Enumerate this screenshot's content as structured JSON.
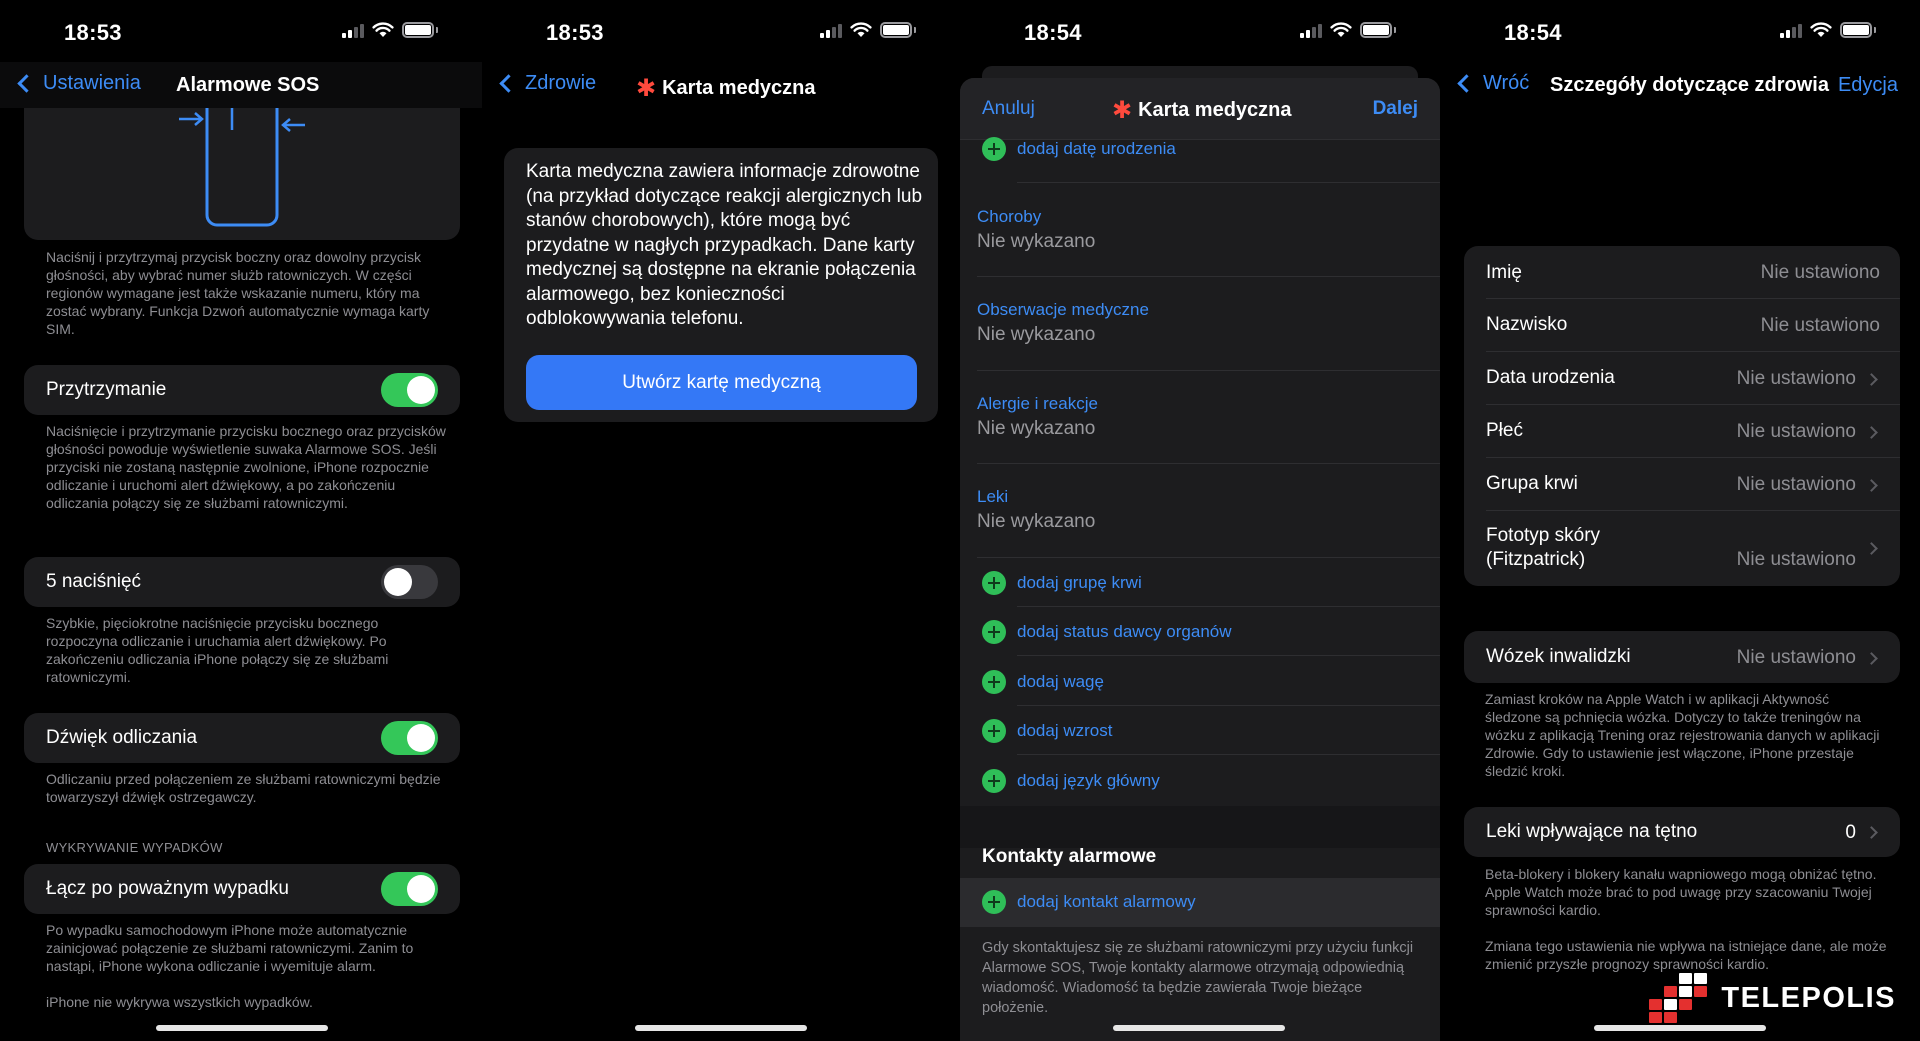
{
  "status": {
    "time_1": "18:53",
    "time_2": "18:53",
    "time_3": "18:54",
    "time_4": "18:54"
  },
  "p1": {
    "back_label": "Ustawienia",
    "title": "Alarmowe SOS",
    "intro": "Naciśnij i przytrzymaj przycisk boczny oraz dowolny przycisk głośności, aby wybrać numer służb ratowniczych. W części regionów wymagane jest także wskazanie numeru, który ma zostać wybrany. Funkcja Dzwoń automatycznie wymaga karty SIM.",
    "hold_label": "Przytrzymanie",
    "hold_on": true,
    "hold_desc": "Naciśnięcie i przytrzymanie przycisku bocznego oraz przycisków głośności powoduje wyświetlenie suwaka Alarmowe SOS. Jeśli przyciski nie zostaną następnie zwolnione, iPhone rozpocznie odliczanie i uruchomi alert dźwiękowy, a po zakończeniu odliczania połączy się ze służbami ratowniczymi.",
    "five_label": "5 naciśnięć",
    "five_on": false,
    "five_desc": "Szybkie, pięciokrotne naciśnięcie przycisku bocznego rozpoczyna odliczanie i uruchamia alert dźwiękowy. Po zakończeniu odliczania iPhone połączy się ze służbami ratowniczymi.",
    "sound_label": "Dźwięk odliczania",
    "sound_on": true,
    "sound_desc": "Odliczaniu przed połączeniem ze służbami ratowniczymi będzie towarzyszył dźwięk ostrzegawczy.",
    "section_header": "WYKRYWANIE WYPADKÓW",
    "crash_label": "Łącz po poważnym wypadku",
    "crash_on": true,
    "crash_desc": "Po wypadku samochodowym iPhone może automatycznie zainicjować połączenie ze służbami ratowniczymi. Zanim to nastąpi, iPhone wykona odliczanie i wyemituje alarm.",
    "crash_note": "iPhone nie wykrywa wszystkich wypadków."
  },
  "p2": {
    "back_label": "Zdrowie",
    "title": "Karta medyczna",
    "info": "Karta medyczna zawiera informacje zdrowotne (na przykład dotyczące reakcji alergicznych lub stanów chorobowych), które mogą być przydatne w nagłych przypadkach. Dane karty medycznej są dostępne na ekranie połączenia alarmowego, bez konieczności odblokowywania telefonu.",
    "create_button": "Utwórz kartę medyczną"
  },
  "p3": {
    "cancel": "Anuluj",
    "title": "Karta medyczna",
    "next": "Dalej",
    "add_birthdate": "dodaj datę urodzenia",
    "fields": [
      {
        "label": "Choroby",
        "value": "Nie wykazano"
      },
      {
        "label": "Obserwacje medyczne",
        "value": "Nie wykazano"
      },
      {
        "label": "Alergie i reakcje",
        "value": "Nie wykazano"
      },
      {
        "label": "Leki",
        "value": "Nie wykazano"
      }
    ],
    "adds": [
      "dodaj grupę krwi",
      "dodaj status dawcy organów",
      "dodaj wagę",
      "dodaj wzrost",
      "dodaj język główny"
    ],
    "contacts_header": "Kontakty alarmowe",
    "add_contact": "dodaj kontakt alarmowy",
    "contacts_desc": "Gdy skontaktujesz się ze służbami ratowniczymi przy użyciu funkcji Alarmowe SOS, Twoje kontakty alarmowe otrzymają odpowiednią wiadomość. Wiadomość ta będzie zawierała Twoje bieżące położenie."
  },
  "p4": {
    "back_label": "Wróć",
    "title": "Szczegóły dotyczące zdrowia",
    "edit": "Edycja",
    "rows": [
      {
        "label": "Imię",
        "value": "Nie ustawiono"
      },
      {
        "label": "Nazwisko",
        "value": "Nie ustawiono"
      },
      {
        "label": "Data urodzenia",
        "value": "Nie ustawiono"
      },
      {
        "label": "Płeć",
        "value": "Nie ustawiono"
      },
      {
        "label": "Grupa krwi",
        "value": "Nie ustawiono"
      },
      {
        "label": "Fototyp skóry\n(Fitzpatrick)",
        "value": "Nie ustawiono"
      }
    ],
    "wheelchair_label": "Wózek inwalidzki",
    "wheelchair_value": "Nie ustawiono",
    "wheelchair_desc": "Zamiast kroków na Apple Watch i w aplikacji Aktywność śledzone są pchnięcia wózka. Dotyczy to także treningów na wózku z aplikacją Trening oraz rejestrowania danych w aplikacji Zdrowie. Gdy to ustawienie jest włączone, iPhone przestaje śledzić kroki.",
    "meds_label": "Leki wpływające na tętno",
    "meds_value": "0",
    "meds_desc1": "Beta-blokery i blokery kanału wapniowego mogą obniżać tętno. Apple Watch może brać to pod uwagę przy szacowaniu Twojej sprawności kardio.",
    "meds_desc2": "Zmiana tego ustawienia nie wpływa na istniejące dane, ale może zmienić przyszłe prognozy sprawności kardio."
  },
  "watermark": "TELEPOLIS",
  "colors": {
    "accent": "#3d8cf5",
    "toggle_on": "#34c759",
    "add_green": "#2fbe58",
    "star_red": "#ff4a3d",
    "cell_bg": "#1c1c1e"
  }
}
